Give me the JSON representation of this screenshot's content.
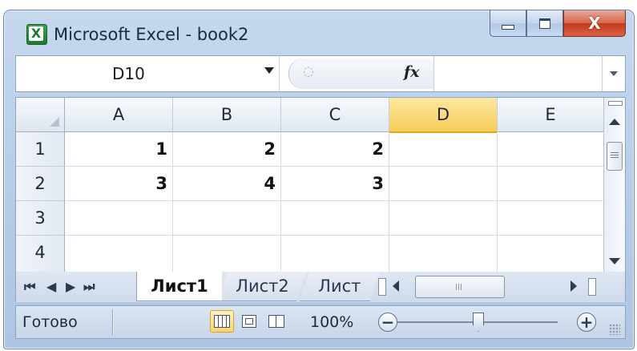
{
  "window": {
    "title": "Microsoft Excel - book2",
    "app_icon_letter": "X",
    "buttons": {
      "minimize": "minimize",
      "maximize": "maximize",
      "close": "close"
    }
  },
  "formula_bar": {
    "name_box": "D10",
    "fx_label": "fx",
    "formula_value": ""
  },
  "grid": {
    "columns": [
      "A",
      "B",
      "C",
      "D",
      "E"
    ],
    "selected_column": "D",
    "rows": [
      {
        "label": "1",
        "cells": [
          "1",
          "2",
          "2",
          "",
          ""
        ]
      },
      {
        "label": "2",
        "cells": [
          "3",
          "4",
          "3",
          "",
          ""
        ]
      },
      {
        "label": "3",
        "cells": [
          "",
          "",
          "",
          "",
          ""
        ]
      },
      {
        "label": "4",
        "cells": [
          "",
          "",
          "",
          "",
          ""
        ]
      }
    ]
  },
  "sheet_tabs": [
    {
      "label": "Лист1",
      "active": true
    },
    {
      "label": "Лист2",
      "active": false
    },
    {
      "label": "Лист",
      "active": false
    }
  ],
  "tab_nav": {
    "first": "⏮",
    "prev": "◀",
    "next": "▶",
    "last": "⏭"
  },
  "status_bar": {
    "status": "Готово",
    "zoom": "100%",
    "zoom_level_percent": 100,
    "zoom_out": "−",
    "zoom_in": "+"
  },
  "colors": {
    "selected_header": "#f7cc58",
    "window_frame": "#b4cbe6",
    "close_button": "#c3391d"
  }
}
